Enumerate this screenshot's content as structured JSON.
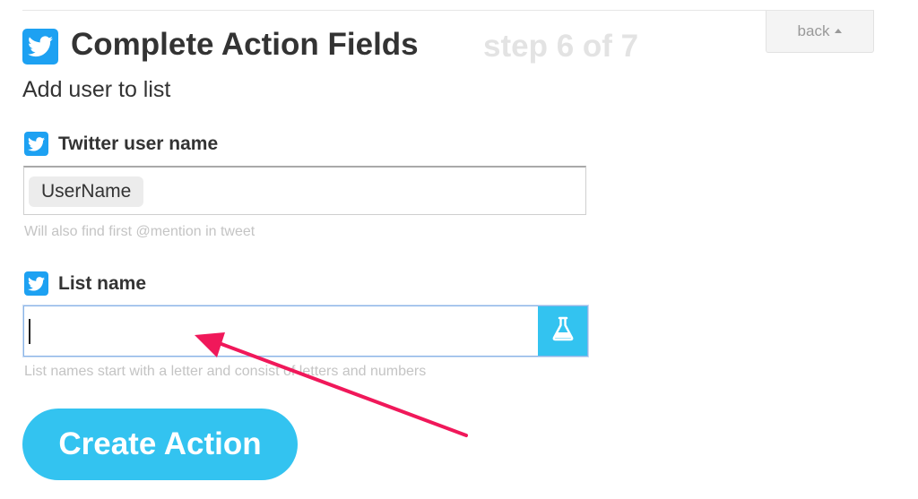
{
  "header": {
    "title": "Complete Action Fields",
    "step_text": "step 6 of 7",
    "back_label": "back",
    "subtitle": "Add user to list"
  },
  "fields": [
    {
      "label": "Twitter user name",
      "token": "UserName",
      "help": "Will also find first @mention in tweet"
    },
    {
      "label": "List name",
      "value": "",
      "help": "List names start with a letter and consist of letters and numbers"
    }
  ],
  "submit": {
    "label": "Create Action"
  },
  "colors": {
    "twitter_blue": "#1da1f2",
    "accent_cyan": "#33c3f0",
    "annotation_arrow": "#f0185a"
  },
  "icons": {
    "service": "twitter-bird-icon",
    "ingredient": "flask-icon",
    "back": "caret-up-icon"
  }
}
